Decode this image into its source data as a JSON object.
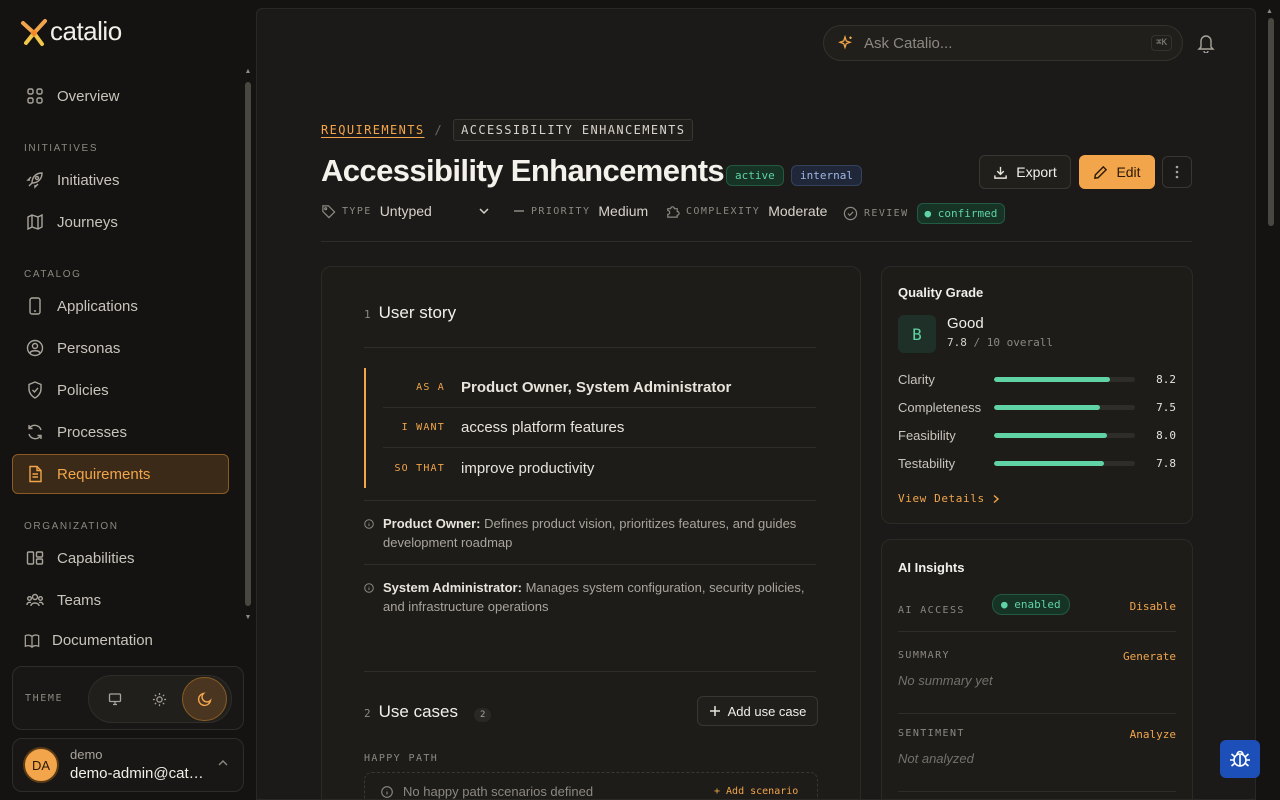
{
  "brand": {
    "name": "catalio"
  },
  "sidebar": {
    "overview": "Overview",
    "section_initiatives": "INITIATIVES",
    "initiatives": "Initiatives",
    "journeys": "Journeys",
    "section_catalog": "CATALOG",
    "applications": "Applications",
    "personas": "Personas",
    "policies": "Policies",
    "processes": "Processes",
    "requirements": "Requirements",
    "section_organization": "ORGANIZATION",
    "capabilities": "Capabilities",
    "teams": "Teams",
    "documentation": "Documentation",
    "theme_label": "THEME",
    "user": {
      "initials": "DA",
      "name": "demo",
      "email": "demo-admin@catalio.com"
    }
  },
  "topbar": {
    "search_placeholder": "Ask Catalio...",
    "search_shortcut": "⌘K"
  },
  "breadcrumb": {
    "parent": "REQUIREMENTS",
    "separator": "/",
    "current": "ACCESSIBILITY ENHANCEMENTS"
  },
  "header": {
    "title": "Accessibility Enhancements",
    "badges": {
      "status": "active",
      "visibility": "internal"
    },
    "export_label": "Export",
    "edit_label": "Edit"
  },
  "meta": {
    "type_label": "TYPE",
    "type_value": "Untyped",
    "priority_label": "PRIORITY",
    "priority_value": "Medium",
    "complexity_label": "COMPLEXITY",
    "complexity_value": "Moderate",
    "review_label": "REVIEW",
    "review_value": "confirmed"
  },
  "user_story": {
    "number": "1",
    "title": "User story",
    "as_a_label": "AS A",
    "as_a": "Product Owner, System Administrator",
    "i_want_label": "I WANT",
    "i_want": "access platform features",
    "so_that_label": "SO THAT",
    "so_that": "improve productivity",
    "personas": [
      {
        "name": "Product Owner:",
        "desc": "Defines product vision, prioritizes features, and guides development roadmap"
      },
      {
        "name": "System Administrator:",
        "desc": "Manages system configuration, security policies, and infrastructure operations"
      }
    ]
  },
  "use_cases": {
    "number": "2",
    "title": "Use cases",
    "count": "2",
    "add_label": "Add use case",
    "happy_path_label": "HAPPY PATH",
    "happy_path_empty": "No happy path scenarios defined",
    "add_scenario": "+ Add scenario"
  },
  "quality": {
    "title": "Quality Grade",
    "grade": "B",
    "grade_label": "Good",
    "score": "7.8",
    "score_suffix": "/ 10 overall",
    "metrics": [
      {
        "name": "Clarity",
        "value": "8.2",
        "fraction": 0.82
      },
      {
        "name": "Completeness",
        "value": "7.5",
        "fraction": 0.75
      },
      {
        "name": "Feasibility",
        "value": "8.0",
        "fraction": 0.8
      },
      {
        "name": "Testability",
        "value": "7.8",
        "fraction": 0.78
      }
    ],
    "view_details": "View Details"
  },
  "ai_insights": {
    "title": "AI Insights",
    "access_label": "AI ACCESS",
    "access_value": "enabled",
    "access_action": "Disable",
    "summary_label": "SUMMARY",
    "summary_action": "Generate",
    "summary_empty": "No summary yet",
    "sentiment_label": "SENTIMENT",
    "sentiment_action": "Analyze",
    "sentiment_empty": "Not analyzed"
  },
  "colors": {
    "accent": "#f2a54a",
    "success": "#5fd3a3",
    "info": "#9fb7e8",
    "background": "#141311",
    "panel": "#1b1a18"
  }
}
